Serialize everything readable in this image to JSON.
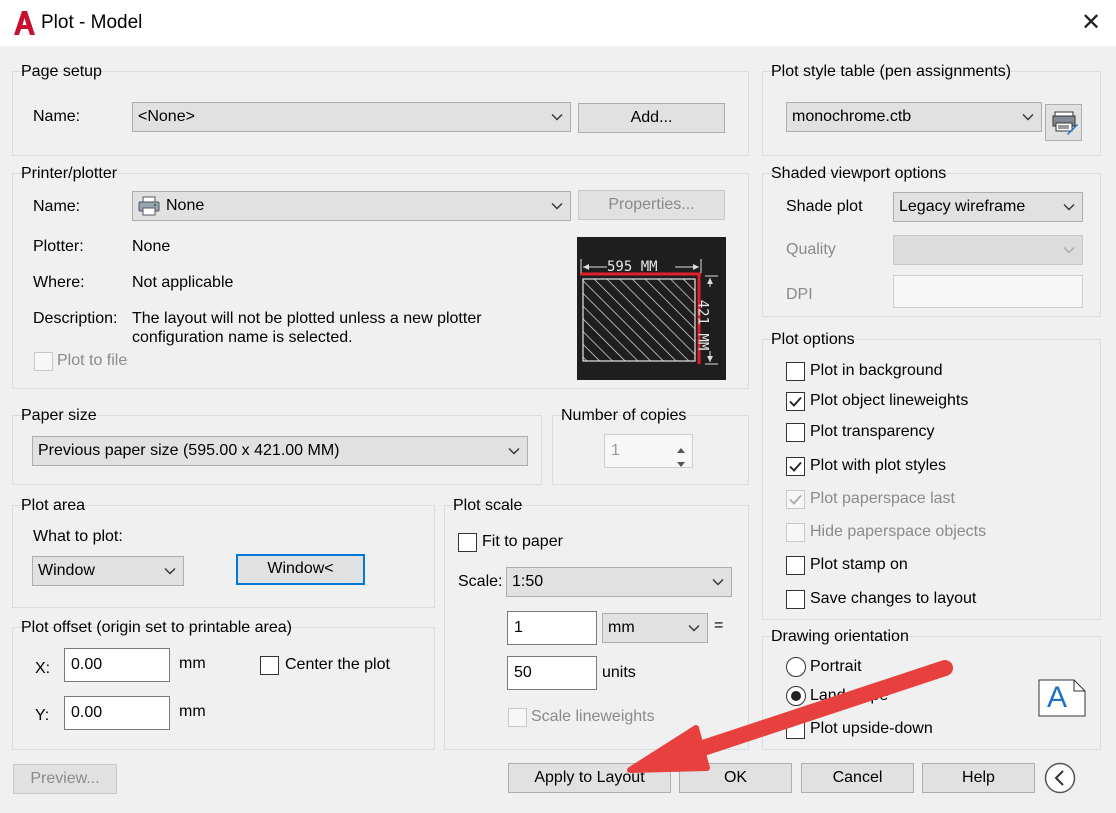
{
  "window": {
    "title": "Plot - Model"
  },
  "page_setup": {
    "heading": "Page setup",
    "name_label": "Name:",
    "name_value": "<None>",
    "add_button": "Add..."
  },
  "printer": {
    "heading": "Printer/plotter",
    "name_label": "Name:",
    "name_value": "None",
    "properties_button": "Properties...",
    "plotter_label": "Plotter:",
    "plotter_value": "None",
    "where_label": "Where:",
    "where_value": "Not applicable",
    "description_label": "Description:",
    "description_line1": "The layout will not be plotted unless a new plotter",
    "description_line2": "configuration name is selected.",
    "plot_to_file": "Plot to file",
    "preview_width": "595 MM",
    "preview_height": "421 MM"
  },
  "paper_size": {
    "heading": "Paper size",
    "value": "Previous paper size (595.00 x 421.00 MM)"
  },
  "copies": {
    "heading": "Number of copies",
    "value": "1"
  },
  "plot_area": {
    "heading": "Plot area",
    "what_label": "What to plot:",
    "what_value": "Window",
    "window_button": "Window<"
  },
  "plot_offset": {
    "heading": "Plot offset (origin set to printable area)",
    "x_label": "X:",
    "x_value": "0.00",
    "x_unit": "mm",
    "y_label": "Y:",
    "y_value": "0.00",
    "y_unit": "mm",
    "center": "Center the plot"
  },
  "plot_scale": {
    "heading": "Plot scale",
    "fit": "Fit to paper",
    "scale_label": "Scale:",
    "scale_value": "1:50",
    "num_value": "1",
    "unit_value": "mm",
    "equals": "=",
    "den_value": "50",
    "den_unit": "units",
    "lineweights": "Scale lineweights"
  },
  "plot_style": {
    "heading": "Plot style table (pen assignments)",
    "value": "monochrome.ctb"
  },
  "shaded": {
    "heading": "Shaded viewport options",
    "shade_label": "Shade plot",
    "shade_value": "Legacy wireframe",
    "quality_label": "Quality",
    "dpi_label": "DPI"
  },
  "plot_options": {
    "heading": "Plot options",
    "items": [
      {
        "label": "Plot in background",
        "checked": false,
        "disabled": false
      },
      {
        "label": "Plot object lineweights",
        "checked": true,
        "disabled": false
      },
      {
        "label": "Plot transparency",
        "checked": false,
        "disabled": false
      },
      {
        "label": "Plot with plot styles",
        "checked": true,
        "disabled": false
      },
      {
        "label": "Plot paperspace last",
        "checked": true,
        "disabled": true
      },
      {
        "label": "Hide paperspace objects",
        "checked": false,
        "disabled": true
      },
      {
        "label": "Plot stamp on",
        "checked": false,
        "disabled": false
      },
      {
        "label": "Save changes to layout",
        "checked": false,
        "disabled": false
      }
    ]
  },
  "orientation": {
    "heading": "Drawing orientation",
    "portrait": "Portrait",
    "landscape": "Landscape",
    "upside_down": "Plot upside-down",
    "selected": "Landscape",
    "icon_letter": "A"
  },
  "footer": {
    "preview": "Preview...",
    "apply": "Apply to Layout",
    "ok": "OK",
    "cancel": "Cancel",
    "help": "Help"
  },
  "colors": {
    "accent_blue": "#0078d7",
    "arrow_red": "#e8403f",
    "autocad_red": "#c8102e",
    "preview_bg": "#1e1e1e"
  }
}
